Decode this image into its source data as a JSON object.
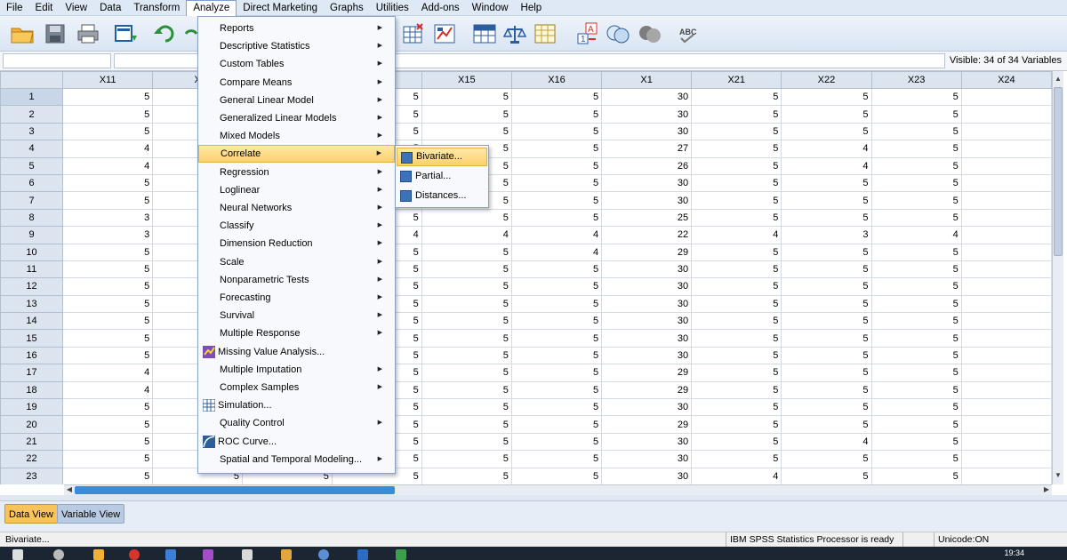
{
  "menubar": {
    "items": [
      "File",
      "Edit",
      "View",
      "Data",
      "Transform",
      "Analyze",
      "Direct Marketing",
      "Graphs",
      "Utilities",
      "Add-ons",
      "Window",
      "Help"
    ],
    "active": "Analyze"
  },
  "editbar": {
    "visible_text": "Visible: 34 of 34 Variables"
  },
  "grid": {
    "columns": [
      "X11",
      "X",
      "",
      "",
      "X15",
      "X16",
      "X1",
      "X21",
      "X22",
      "X23",
      "X24"
    ],
    "rows": [
      {
        "n": "1",
        "v": [
          "5",
          "",
          "",
          "5",
          "5",
          "5",
          "30",
          "5",
          "5",
          "5",
          ""
        ]
      },
      {
        "n": "2",
        "v": [
          "5",
          "",
          "",
          "5",
          "5",
          "5",
          "30",
          "5",
          "5",
          "5",
          ""
        ]
      },
      {
        "n": "3",
        "v": [
          "5",
          "",
          "",
          "5",
          "5",
          "5",
          "30",
          "5",
          "5",
          "5",
          ""
        ]
      },
      {
        "n": "4",
        "v": [
          "4",
          "",
          "",
          "5",
          "5",
          "5",
          "27",
          "5",
          "4",
          "5",
          ""
        ]
      },
      {
        "n": "5",
        "v": [
          "4",
          "",
          "",
          "",
          "5",
          "5",
          "26",
          "5",
          "4",
          "5",
          ""
        ]
      },
      {
        "n": "6",
        "v": [
          "5",
          "",
          "",
          "",
          "5",
          "5",
          "30",
          "5",
          "5",
          "5",
          ""
        ]
      },
      {
        "n": "7",
        "v": [
          "5",
          "",
          "",
          "",
          "5",
          "5",
          "30",
          "5",
          "5",
          "5",
          ""
        ]
      },
      {
        "n": "8",
        "v": [
          "3",
          "",
          "",
          "5",
          "5",
          "5",
          "25",
          "5",
          "5",
          "5",
          ""
        ]
      },
      {
        "n": "9",
        "v": [
          "3",
          "",
          "",
          "4",
          "4",
          "4",
          "22",
          "4",
          "3",
          "4",
          ""
        ]
      },
      {
        "n": "10",
        "v": [
          "5",
          "",
          "",
          "5",
          "5",
          "4",
          "29",
          "5",
          "5",
          "5",
          ""
        ]
      },
      {
        "n": "11",
        "v": [
          "5",
          "",
          "",
          "5",
          "5",
          "5",
          "30",
          "5",
          "5",
          "5",
          ""
        ]
      },
      {
        "n": "12",
        "v": [
          "5",
          "",
          "",
          "5",
          "5",
          "5",
          "30",
          "5",
          "5",
          "5",
          ""
        ]
      },
      {
        "n": "13",
        "v": [
          "5",
          "",
          "",
          "5",
          "5",
          "5",
          "30",
          "5",
          "5",
          "5",
          ""
        ]
      },
      {
        "n": "14",
        "v": [
          "5",
          "",
          "",
          "5",
          "5",
          "5",
          "30",
          "5",
          "5",
          "5",
          ""
        ]
      },
      {
        "n": "15",
        "v": [
          "5",
          "",
          "",
          "5",
          "5",
          "5",
          "30",
          "5",
          "5",
          "5",
          ""
        ]
      },
      {
        "n": "16",
        "v": [
          "5",
          "",
          "",
          "5",
          "5",
          "5",
          "30",
          "5",
          "5",
          "5",
          ""
        ]
      },
      {
        "n": "17",
        "v": [
          "4",
          "",
          "",
          "5",
          "5",
          "5",
          "29",
          "5",
          "5",
          "5",
          ""
        ]
      },
      {
        "n": "18",
        "v": [
          "4",
          "",
          "",
          "5",
          "5",
          "5",
          "29",
          "5",
          "5",
          "5",
          ""
        ]
      },
      {
        "n": "19",
        "v": [
          "5",
          "",
          "",
          "5",
          "5",
          "5",
          "30",
          "5",
          "5",
          "5",
          ""
        ]
      },
      {
        "n": "20",
        "v": [
          "5",
          "",
          "",
          "5",
          "5",
          "5",
          "29",
          "5",
          "5",
          "5",
          ""
        ]
      },
      {
        "n": "21",
        "v": [
          "5",
          "",
          "",
          "5",
          "5",
          "5",
          "30",
          "5",
          "4",
          "5",
          ""
        ]
      },
      {
        "n": "22",
        "v": [
          "5",
          "",
          "",
          "5",
          "5",
          "5",
          "30",
          "5",
          "5",
          "5",
          ""
        ]
      },
      {
        "n": "23",
        "v": [
          "5",
          "5",
          "5",
          "5",
          "5",
          "5",
          "30",
          "4",
          "5",
          "5",
          ""
        ]
      }
    ]
  },
  "analyze_menu": {
    "items": [
      {
        "label": "Reports",
        "sub": true,
        "icon": ""
      },
      {
        "label": "Descriptive Statistics",
        "sub": true,
        "icon": ""
      },
      {
        "label": "Custom Tables",
        "sub": true,
        "icon": ""
      },
      {
        "label": "Compare Means",
        "sub": true,
        "icon": ""
      },
      {
        "label": "General Linear Model",
        "sub": true,
        "icon": ""
      },
      {
        "label": "Generalized Linear Models",
        "sub": true,
        "icon": ""
      },
      {
        "label": "Mixed Models",
        "sub": true,
        "icon": ""
      },
      {
        "label": "Correlate",
        "sub": true,
        "icon": "",
        "highlight": true
      },
      {
        "label": "Regression",
        "sub": true,
        "icon": ""
      },
      {
        "label": "Loglinear",
        "sub": true,
        "icon": ""
      },
      {
        "label": "Neural Networks",
        "sub": true,
        "icon": ""
      },
      {
        "label": "Classify",
        "sub": true,
        "icon": ""
      },
      {
        "label": "Dimension Reduction",
        "sub": true,
        "icon": ""
      },
      {
        "label": "Scale",
        "sub": true,
        "icon": ""
      },
      {
        "label": "Nonparametric Tests",
        "sub": true,
        "icon": ""
      },
      {
        "label": "Forecasting",
        "sub": true,
        "icon": ""
      },
      {
        "label": "Survival",
        "sub": true,
        "icon": ""
      },
      {
        "label": "Multiple Response",
        "sub": true,
        "icon": ""
      },
      {
        "label": "Missing Value Analysis...",
        "sub": false,
        "icon": "missing-value-icon"
      },
      {
        "label": "Multiple Imputation",
        "sub": true,
        "icon": ""
      },
      {
        "label": "Complex Samples",
        "sub": true,
        "icon": ""
      },
      {
        "label": "Simulation...",
        "sub": false,
        "icon": "simulation-icon"
      },
      {
        "label": "Quality Control",
        "sub": true,
        "icon": ""
      },
      {
        "label": "ROC Curve...",
        "sub": false,
        "icon": "roc-curve-icon"
      },
      {
        "label": "Spatial and Temporal Modeling...",
        "sub": true,
        "icon": ""
      }
    ]
  },
  "correlate_submenu": {
    "items": [
      {
        "label": "Bivariate...",
        "highlight": true,
        "icon": "bivariate-icon"
      },
      {
        "label": "Partial...",
        "highlight": false,
        "icon": "partial-icon"
      },
      {
        "label": "Distances...",
        "highlight": false,
        "icon": "distances-icon"
      }
    ]
  },
  "view_tabs": {
    "data_view": "Data View",
    "variable_view": "Variable View"
  },
  "status": {
    "left": "Bivariate...",
    "processor": "IBM SPSS Statistics Processor is ready",
    "unicode": "Unicode:ON"
  },
  "taskbar": {
    "clock": "19:34"
  },
  "colors": {
    "accent": "#fcd06a",
    "menubar_bg": "#dfe9f5",
    "header_bg": "#dbe4ef"
  }
}
